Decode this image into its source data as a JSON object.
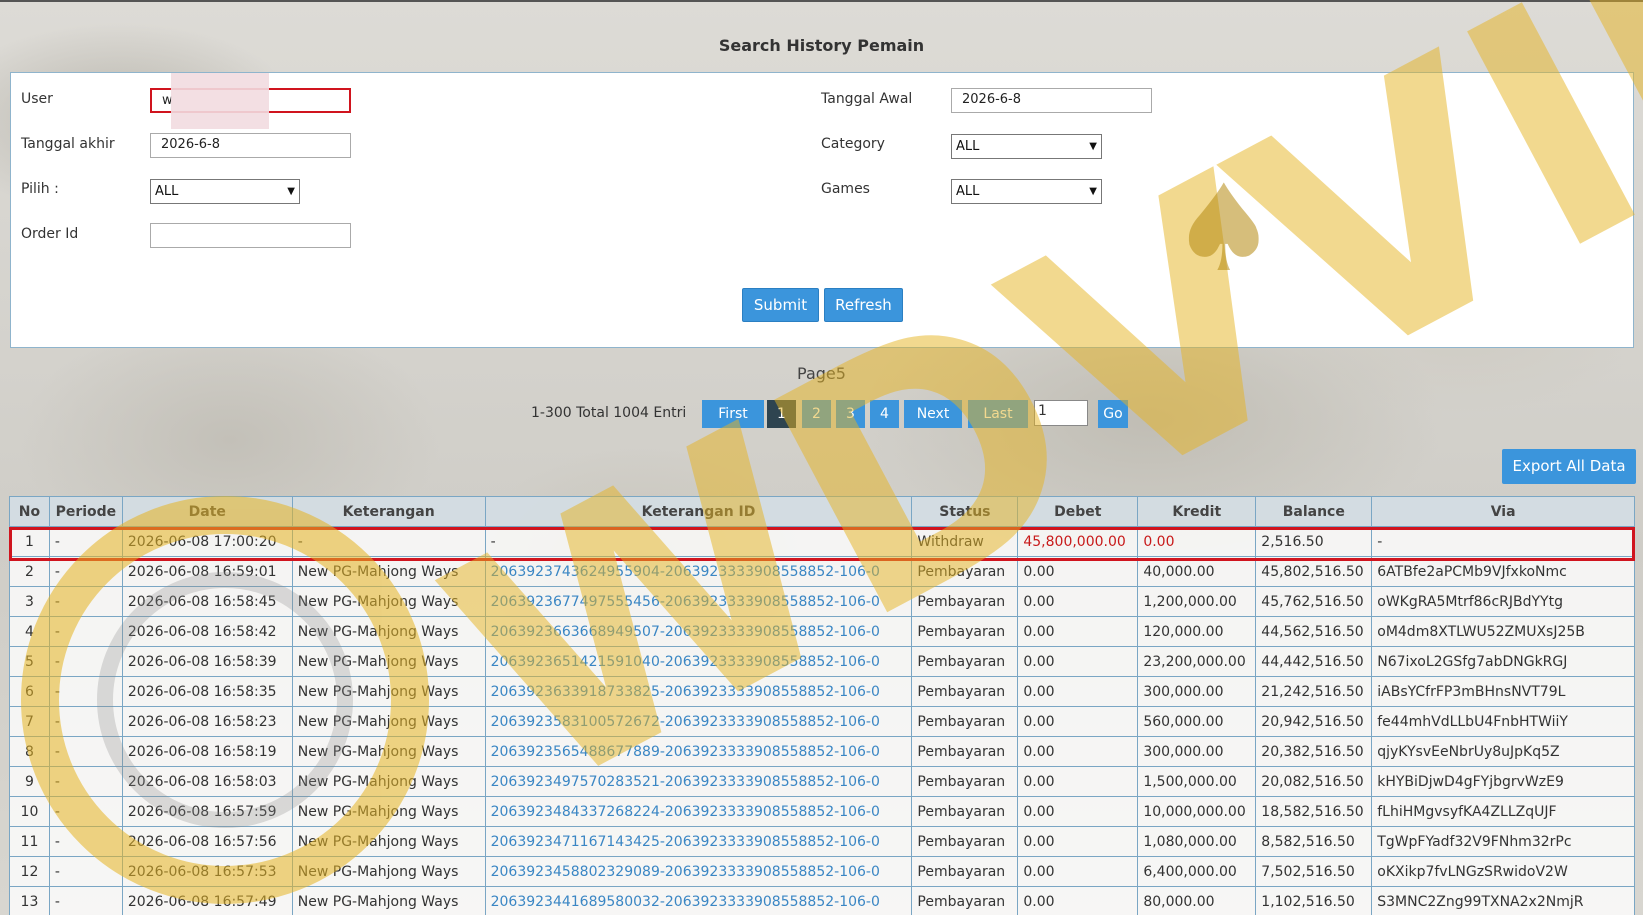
{
  "page": {
    "title": "Search History Pemain"
  },
  "form": {
    "user_label": "User",
    "user_value": "w",
    "tanggal_awal_label": "Tanggal Awal",
    "tanggal_awal_value": "2026-6-8",
    "tanggal_akhir_label": "Tanggal akhir",
    "tanggal_akhir_value": "2026-6-8",
    "category_label": "Category",
    "category_value": "ALL",
    "pilih_label": "Pilih  :",
    "pilih_value": "ALL",
    "games_label": "Games",
    "games_value": "ALL",
    "order_id_label": "Order Id",
    "order_id_value": "",
    "submit_label": "Submit",
    "refresh_label": "Refresh"
  },
  "pagination": {
    "pages_label": "Page5",
    "entries_text": "1-300 Total 1004 Entri",
    "first_label": "First",
    "pages": [
      "1",
      "2",
      "3",
      "4"
    ],
    "active_page": "1",
    "next_label": "Next",
    "last_label": "Last",
    "goto_value": "1",
    "go_label": "Go"
  },
  "export_label": "Export All Data",
  "table": {
    "headers": [
      "No",
      "Periode",
      "Date",
      "Keterangan",
      "Keterangan ID",
      "Status",
      "Debet",
      "Kredit",
      "Balance",
      "Via"
    ],
    "rows": [
      [
        "1",
        "-",
        "2026-06-08 17:00:20",
        "-",
        "-",
        "Withdraw",
        "45,800,000.00",
        "0.00",
        "2,516.50",
        "-"
      ],
      [
        "2",
        "-",
        "2026-06-08 16:59:01",
        "New PG-Mahjong Ways",
        "2063923743624955904-2063923333908558852-106-0",
        "Pembayaran",
        "0.00",
        "40,000.00",
        "45,802,516.50",
        "6ATBfe2aPCMb9VJfxkoNmc"
      ],
      [
        "3",
        "-",
        "2026-06-08 16:58:45",
        "New PG-Mahjong Ways",
        "2063923677497555456-2063923333908558852-106-0",
        "Pembayaran",
        "0.00",
        "1,200,000.00",
        "45,762,516.50",
        "oWKgRA5Mtrf86cRJBdYYtg"
      ],
      [
        "4",
        "-",
        "2026-06-08 16:58:42",
        "New PG-Mahjong Ways",
        "2063923663668949507-2063923333908558852-106-0",
        "Pembayaran",
        "0.00",
        "120,000.00",
        "44,562,516.50",
        "oM4dm8XTLWU52ZMUXsJ25B"
      ],
      [
        "5",
        "-",
        "2026-06-08 16:58:39",
        "New PG-Mahjong Ways",
        "2063923651421591040-2063923333908558852-106-0",
        "Pembayaran",
        "0.00",
        "23,200,000.00",
        "44,442,516.50",
        "N67ixoL2GSfg7abDNGkRGJ"
      ],
      [
        "6",
        "-",
        "2026-06-08 16:58:35",
        "New PG-Mahjong Ways",
        "2063923633918733825-2063923333908558852-106-0",
        "Pembayaran",
        "0.00",
        "300,000.00",
        "21,242,516.50",
        "iABsYCfrFP3mBHnsNVT79L"
      ],
      [
        "7",
        "-",
        "2026-06-08 16:58:23",
        "New PG-Mahjong Ways",
        "2063923583100572672-2063923333908558852-106-0",
        "Pembayaran",
        "0.00",
        "560,000.00",
        "20,942,516.50",
        "fe44mhVdLLbU4FnbHTWiiY"
      ],
      [
        "8",
        "-",
        "2026-06-08 16:58:19",
        "New PG-Mahjong Ways",
        "2063923565488677889-2063923333908558852-106-0",
        "Pembayaran",
        "0.00",
        "300,000.00",
        "20,382,516.50",
        "qjyKYsvEeNbrUy8uJpKq5Z"
      ],
      [
        "9",
        "-",
        "2026-06-08 16:58:03",
        "New PG-Mahjong Ways",
        "2063923497570283521-2063923333908558852-106-0",
        "Pembayaran",
        "0.00",
        "1,500,000.00",
        "20,082,516.50",
        "kHYBiDjwD4gFYjbgrvWzE9"
      ],
      [
        "10",
        "-",
        "2026-06-08 16:57:59",
        "New PG-Mahjong Ways",
        "2063923484337268224-2063923333908558852-106-0",
        "Pembayaran",
        "0.00",
        "10,000,000.00",
        "18,582,516.50",
        "fLhiHMgvsyfKA4ZLLZqUJF"
      ],
      [
        "11",
        "-",
        "2026-06-08 16:57:56",
        "New PG-Mahjong Ways",
        "2063923471167143425-2063923333908558852-106-0",
        "Pembayaran",
        "0.00",
        "1,080,000.00",
        "8,582,516.50",
        "TgWpFYadf32V9FNhm32rPc"
      ],
      [
        "12",
        "-",
        "2026-06-08 16:57:53",
        "New PG-Mahjong Ways",
        "2063923458802329089-2063923333908558852-106-0",
        "Pembayaran",
        "0.00",
        "6,400,000.00",
        "7,502,516.50",
        "oKXikp7fvLNGzSRwidoV2W"
      ],
      [
        "13",
        "-",
        "2026-06-08 16:57:49",
        "New PG-Mahjong Ways",
        "2063923441689580032-2063923333908558852-106-0",
        "Pembayaran",
        "0.00",
        "80,000.00",
        "1,102,516.50",
        "S3MNC2Zng99TXNA2x2NmjR"
      ]
    ]
  },
  "watermark_text": "WDVVIK",
  "colors": {
    "accent": "#3b95dc",
    "highlight": "#d0141e",
    "link": "#3a86c4",
    "watermark_gold": "#e6b422"
  }
}
